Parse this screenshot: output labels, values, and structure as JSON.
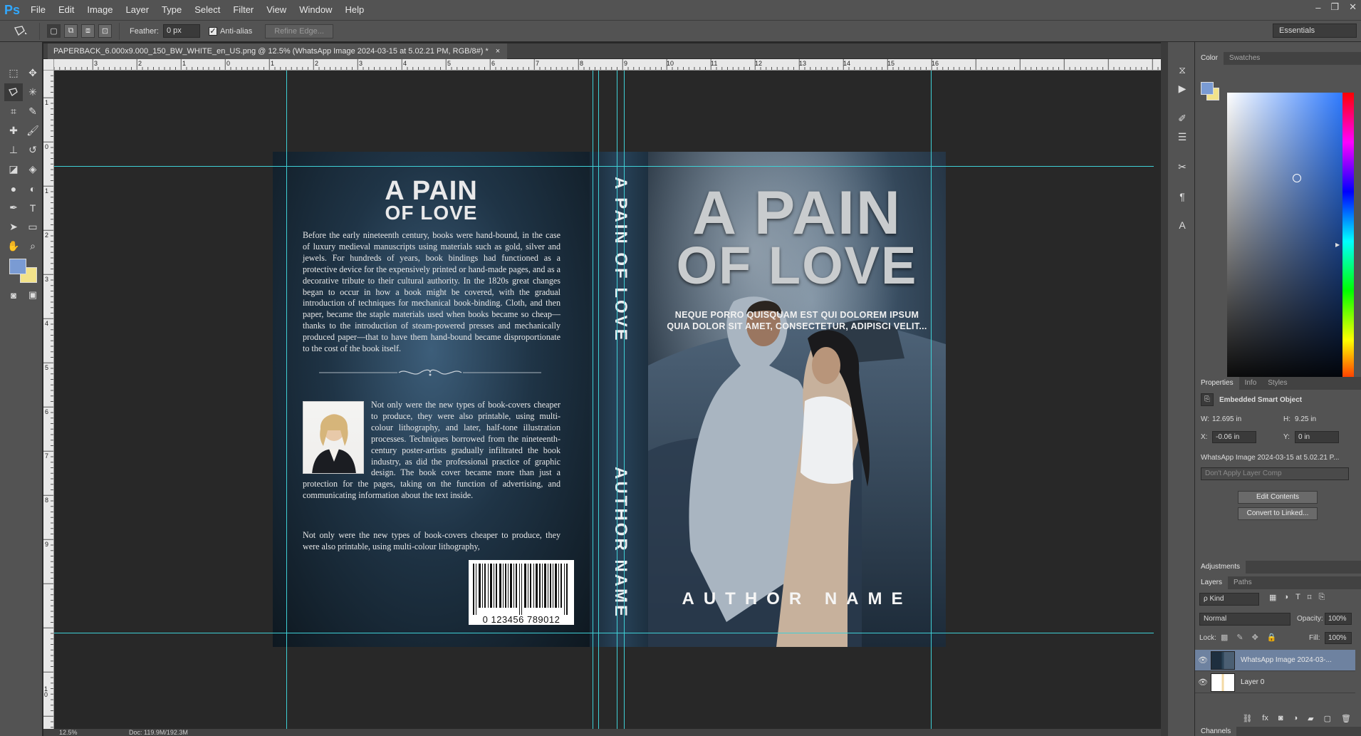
{
  "app": {
    "logo": "Ps",
    "menu": [
      "File",
      "Edit",
      "Image",
      "Layer",
      "Type",
      "Select",
      "Filter",
      "View",
      "Window",
      "Help"
    ],
    "window_controls": [
      "–",
      "❐",
      "✕"
    ]
  },
  "options_bar": {
    "feather_label": "Feather:",
    "feather_value": "0 px",
    "antialias_label": "Anti-alias",
    "antialias_checked": "✓",
    "refine_edge_label": "Refine Edge...",
    "workspace": "Essentials"
  },
  "document": {
    "tab_title": "PAPERBACK_6.000x9.000_150_BW_WHITE_en_US.png @ 12.5% (WhatsApp Image 2024-03-15 at 5.02.21 PM, RGB/8#) *",
    "tab_close": "×",
    "ruler_top": [
      "3",
      "2",
      "1",
      "0",
      "1",
      "2",
      "3",
      "4",
      "5",
      "6",
      "7",
      "8",
      "9",
      "10",
      "11",
      "12",
      "13",
      "14",
      "15",
      "16"
    ],
    "ruler_left": [
      "1",
      "0",
      "1",
      "2",
      "3",
      "4",
      "5",
      "6",
      "7",
      "8",
      "9",
      "1 0"
    ],
    "status_zoom": "12.5%",
    "status_doc": "Doc: 119.9M/192.3M"
  },
  "cover": {
    "back_title_line1": "A PAIN",
    "back_title_line2": "OF LOVE",
    "back_paragraph1": "Before the early nineteenth century, books were hand-bound, in the case of luxury medieval manuscripts using materials such as gold, silver and jewels. For hundreds of years, book bindings had functioned as a protective device for the expensively printed or hand-made pages, and as a decorative tribute to their cultural authority. In the 1820s great changes began to occur in how a book might be covered, with the gradual introduction of techniques for mechanical book-binding. Cloth, and then paper, became the staple materials used when books became so cheap—thanks to the introduction of steam-powered presses and mechanically produced paper—that to have them hand-bound became disproportionate to the cost of the book itself.",
    "author_bio": "Not only were the new types of book-covers cheaper to produce, they were also printable, using multi-colour lithography, and later, half-tone illustration processes. Techniques borrowed from the nineteenth-century poster-artists gradually infiltrated the book industry, as did the professional practice of graphic design. The book cover became more than just a protection for the pages, taking on the function of advertising, and communicating information about the text inside.",
    "back_paragraph3": "Not only were the new types of book-covers cheaper to produce, they were also printable, using multi-colour lithography,",
    "barcode_number": "0  123456  789012",
    "spine_title": "A PAIN OF LOVE",
    "spine_author": "AUTHOR NAME",
    "front_title_line1": "A PAIN",
    "front_title_line2": "OF LOVE",
    "front_subtitle_line1": "NEQUE PORRO QUISQUAM EST QUI DOLOREM IPSUM",
    "front_subtitle_line2": "QUIA DOLOR SIT AMET, CONSECTETUR, ADIPISCI VELIT...",
    "front_author": "AUTHOR NAME"
  },
  "color_panel": {
    "tabs": [
      "Color",
      "Swatches"
    ],
    "fg_color": "#7a9bd3",
    "bg_color": "#f2e28a"
  },
  "properties_panel": {
    "tabs": [
      "Properties",
      "Info",
      "Styles"
    ],
    "object_type": "Embedded Smart Object",
    "w_label": "W:",
    "w_value": "12.695 in",
    "h_label": "H:",
    "h_value": "9.25 in",
    "x_label": "X:",
    "x_value": "-0.06 in",
    "y_label": "Y:",
    "y_value": "0 in",
    "source_name": "WhatsApp Image 2024-03-15 at 5.02.21 P...",
    "layer_comp": "Don't Apply Layer Comp",
    "edit_contents": "Edit Contents",
    "convert_linked": "Convert to Linked..."
  },
  "adjustments_panel": {
    "title": "Adjustments"
  },
  "layers_panel": {
    "tabs": [
      "Layers",
      "Paths"
    ],
    "kind_filter": "ρ Kind",
    "blend_mode": "Normal",
    "opacity_label": "Opacity:",
    "opacity_value": "100%",
    "lock_label": "Lock:",
    "fill_label": "Fill:",
    "fill_value": "100%",
    "layers": [
      {
        "name": "WhatsApp Image 2024-03-...",
        "visible": "👁"
      },
      {
        "name": "Layer 0",
        "visible": "👁"
      }
    ]
  },
  "channels_panel": {
    "title": "Channels"
  }
}
